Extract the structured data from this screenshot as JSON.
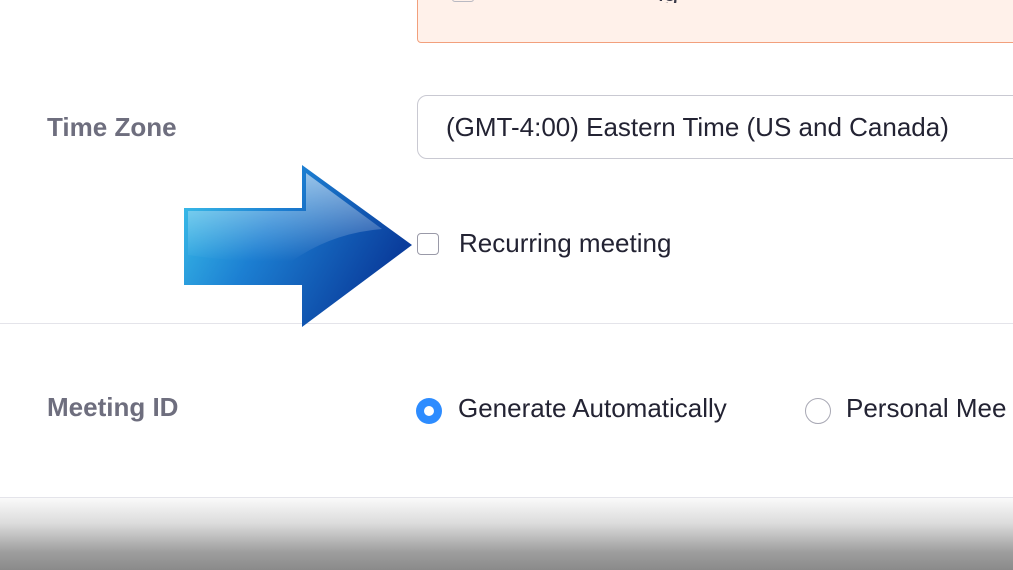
{
  "form": {
    "time_zone": {
      "label": "Time Zone",
      "selected_value": "(GMT-4:00) Eastern Time (US and Canada)"
    },
    "recurring": {
      "label": "Recurring meeting",
      "checked": false
    },
    "meeting_id": {
      "label": "Meeting ID",
      "options": [
        {
          "label": "Generate Automatically",
          "selected": true
        },
        {
          "label": "Personal Mee",
          "selected": false
        }
      ]
    }
  },
  "annotation": {
    "icon": "arrow-right-icon",
    "colors": {
      "light": "#3ec6ec",
      "dark": "#0a3d9c"
    }
  },
  "colors": {
    "accent": "#2d8cff",
    "warning_border": "#f2a07c",
    "warning_background": "#fff1ea",
    "label_text": "#6e6e7e",
    "body_text": "#232333"
  }
}
